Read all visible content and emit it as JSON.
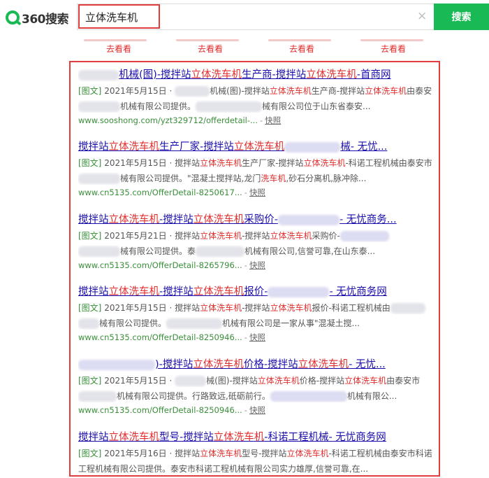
{
  "header": {
    "logo_text": "360搜索",
    "search_value": "立体洗车机",
    "clear_icon": "×",
    "search_button": "搜索"
  },
  "recommend": {
    "labels": [
      "去看看",
      "去看看",
      "去看看",
      "去看看"
    ]
  },
  "results": [
    {
      "title_parts": [
        "机械(图)-搅拌站",
        "立体洗车机",
        "生产商-搅拌站",
        "立体洗车机",
        "-首商网"
      ],
      "line1_parts": [
        "[图文]",
        " 2021年5月15日 · ",
        "机械(图)-搅拌站",
        "立体洗车机",
        "生产商-搅拌站",
        "立体洗车机",
        "由泰安"
      ],
      "line2": "机械有限公司提供。",
      "line2b": "械有限公司位于山东省泰安...",
      "url": "www.sooshong.com/yzt329712/offerdetail-...",
      "snapshot": "快照"
    },
    {
      "title_parts": [
        "搅拌站",
        "立体洗车机",
        "生产厂家-搅拌站",
        "立体洗车机",
        "械- 无忧..."
      ],
      "line1_parts": [
        "[图文]",
        " 2021年5月15日 · 搅拌站",
        "立体洗车机",
        "生产厂家-搅拌站",
        "立体洗车机",
        "-科诺工程机械由泰安市"
      ],
      "line2": "械有限公司提供。\"混凝土搅拌站,龙门",
      "line2_hl": "洗车机",
      "line2c": ",砂石分离机,脉冲除...",
      "url": "www.cn5135.com/OfferDetail-8250617...",
      "snapshot": "快照"
    },
    {
      "title_parts": [
        "搅拌站",
        "立体洗车机",
        "-搅拌站",
        "立体洗车机",
        "采购价-",
        "- 无忧商务..."
      ],
      "line1_parts": [
        "[图文]",
        " 2021年5月21日 · 搅拌站",
        "立体洗车机",
        "-搅拌站",
        "立体洗车机",
        "采购价-"
      ],
      "line2": "械有限公司提供。泰",
      "line2b": "机械有限公司,信誉可靠,在山东泰...",
      "url": "www.cn5135.com/OfferDetail-8265796...",
      "snapshot": "快照"
    },
    {
      "title_parts": [
        "搅拌站",
        "立体洗车机",
        "-搅拌站",
        "立体洗车机",
        "报价-",
        "- 无忧商务网"
      ],
      "line1_parts": [
        "[图文]",
        " 2021年5月15日 · 搅拌站",
        "立体洗车机",
        "-搅拌站",
        "立体洗车机",
        "报价-科诺工程机械由"
      ],
      "line2": "械有限公司提供。",
      "line2b": "机械有限公司是一家从事\"混凝土搅...",
      "url": "www.cn5135.com/OfferDetail-8250946...",
      "snapshot": "快照"
    },
    {
      "title_parts": [
        ")-搅拌站",
        "立体洗车机",
        "价格-搅拌站",
        "立体洗车机",
        "- 无忧..."
      ],
      "line1_parts": [
        "[图文]",
        " 2021年5月15日 · ",
        "械(图)-搅拌站",
        "立体洗车机",
        "价格-搅拌站",
        "立体洗车机",
        "由泰安市"
      ],
      "line2": "机械有限公司提供。行路致远,砥砺前行。",
      "line2b": "机械有限公...",
      "url": "www.cn5135.com/OfferDetail-8250946...",
      "snapshot": "快照"
    },
    {
      "title_parts": [
        "搅拌站",
        "立体洗车机",
        "型号-搅拌站",
        "立体洗车机",
        "-科诺工程机械- 无忧商务网"
      ],
      "line1_parts": [
        "[图文]",
        " 2021年5月16日 · 搅拌站",
        "立体洗车机",
        "型号-搅拌站",
        "立体洗车机",
        "-科诺工程机械由泰安市科诺"
      ],
      "line2": "工程机械有限公司提供。泰安市科诺工程机械有限公司实力雄厚,信誉可靠,在..."
    }
  ]
}
